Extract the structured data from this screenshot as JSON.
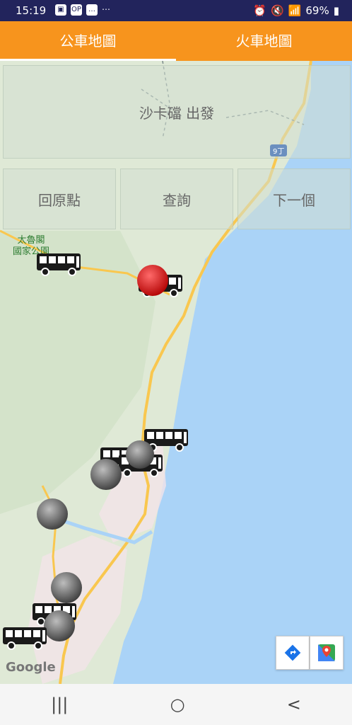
{
  "status_bar": {
    "time": "15:19",
    "left_icons": [
      "gallery-icon",
      "op-icon",
      "chat-icon",
      "more-dots-icon"
    ],
    "battery": "69%"
  },
  "tabs": [
    {
      "label": "公車地圖",
      "active": true
    },
    {
      "label": "火車地圖",
      "active": false
    }
  ],
  "map": {
    "origin_banner": "沙卡礑 出發",
    "buttons": {
      "reset": "回原點",
      "search": "查詢",
      "next": "下一個"
    },
    "places": [
      {
        "name": "太魯閣\n國家公園"
      }
    ],
    "road_label": "9丁",
    "google_logo": "Google"
  },
  "nav": {
    "recents": "|||",
    "home": "○",
    "back": "<"
  },
  "colors": {
    "accent": "#f7941d",
    "status_bar": "#22245c",
    "sea": "#aad3f7",
    "land": "#dfe9d6",
    "road": "#f9c74f",
    "stop_selected": "#e00000",
    "stop": "#555555"
  }
}
